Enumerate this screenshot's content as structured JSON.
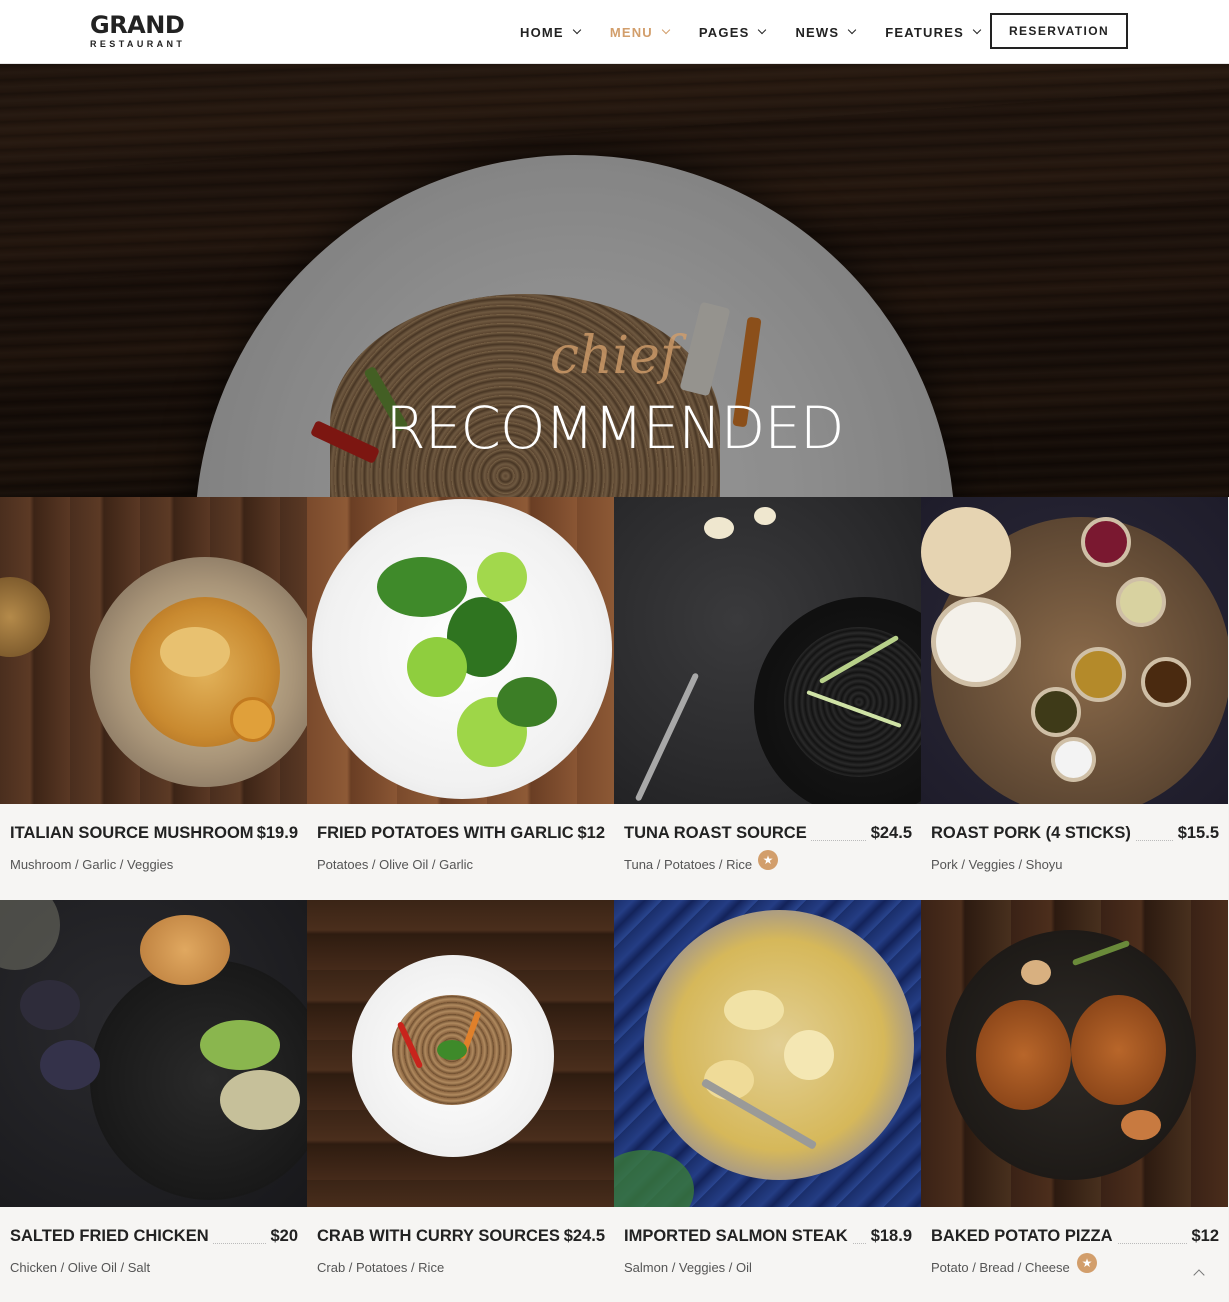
{
  "brand": {
    "name": "GRAND",
    "tagline": "RESTAURANT"
  },
  "nav": {
    "items": [
      {
        "label": "HOME",
        "active": false
      },
      {
        "label": "MENU",
        "active": true
      },
      {
        "label": "PAGES",
        "active": false
      },
      {
        "label": "NEWS",
        "active": false
      },
      {
        "label": "FEATURES",
        "active": false
      }
    ],
    "cta_label": "RESERVATION"
  },
  "hero": {
    "script": "chief",
    "title": "RECOMMENDED"
  },
  "accent_color": "#d29e6b",
  "menu": [
    {
      "name": "ITALIAN SOURCE MUSHROOM",
      "price": "$19.9",
      "ingredients": "Mushroom / Garlic / Veggies",
      "featured": false
    },
    {
      "name": "FRIED POTATOES WITH GARLIC",
      "price": "$12",
      "ingredients": "Potatoes / Olive Oil / Garlic",
      "featured": false
    },
    {
      "name": "TUNA ROAST SOURCE",
      "price": "$24.5",
      "ingredients": "Tuna / Potatoes / Rice",
      "featured": true
    },
    {
      "name": "ROAST PORK (4 STICKS)",
      "price": "$15.5",
      "ingredients": "Pork / Veggies / Shoyu",
      "featured": false
    },
    {
      "name": "SALTED FRIED CHICKEN",
      "price": "$20",
      "ingredients": "Chicken / Olive Oil / Salt",
      "featured": false
    },
    {
      "name": "CRAB WITH CURRY SOURCES",
      "price": "$24.5",
      "ingredients": "Crab / Potatoes / Rice",
      "featured": false
    },
    {
      "name": "IMPORTED SALMON STEAK",
      "price": "$18.9",
      "ingredients": "Salmon / Veggies / Oil",
      "featured": false
    },
    {
      "name": "BAKED POTATO PIZZA",
      "price": "$12",
      "ingredients": "Potato / Bread / Cheese",
      "featured": true
    }
  ],
  "icons": {
    "star": "star-icon",
    "chevron": "chevron-down-icon",
    "scroll_top": "chevron-up-icon"
  }
}
